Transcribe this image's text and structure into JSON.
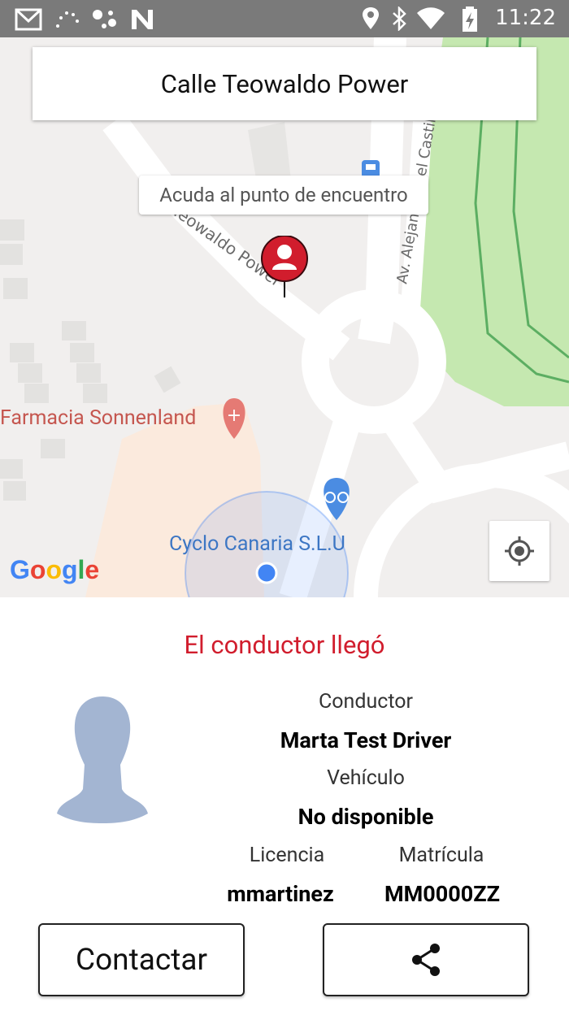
{
  "status_bar": {
    "time": "11:22",
    "icons_left": [
      "gmail-icon",
      "loading-dots-icon",
      "assistant-icon",
      "n-app-icon"
    ],
    "icons_right": [
      "location-icon",
      "bluetooth-icon",
      "wifi-icon",
      "battery-charging-icon"
    ]
  },
  "map": {
    "address": "Calle Teowaldo Power",
    "meeting_label": "Acuda al punto de encuentro",
    "street_label": "Teowaldo Power",
    "avenue_label": "Av. Alejandro del Castillo",
    "pharmacy": "Farmacia Sonnenland",
    "bike_shop": "Cyclo Canaria S.L.U",
    "google": [
      "G",
      "o",
      "o",
      "g",
      "l",
      "e"
    ],
    "google_colors": [
      "#4285f4",
      "#ea4335",
      "#fbbc05",
      "#4285f4",
      "#34a853",
      "#ea4335"
    ]
  },
  "panel": {
    "status": "El conductor llegó",
    "driver_label": "Conductor",
    "driver_name": "Marta Test Driver",
    "vehicle_label": "Vehículo",
    "vehicle_value": "No disponible",
    "license_label": "Licencia",
    "license_value": "mmartinez",
    "plate_label": "Matrícula",
    "plate_value": "MM0000ZZ",
    "contact_button": "Contactar",
    "share_icon": "share-icon"
  },
  "colors": {
    "accent_red": "#d11d2d",
    "status_bar": "#7a7a7a",
    "park_green": "#c5e8b0",
    "location_blue": "#4285f4"
  }
}
